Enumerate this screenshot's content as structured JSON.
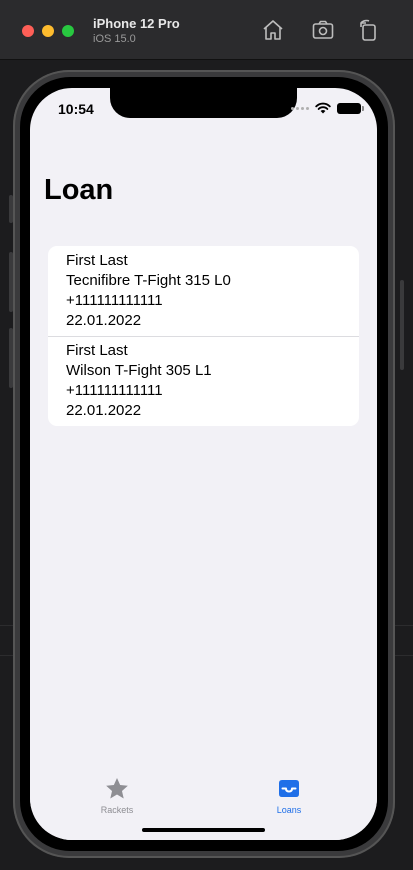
{
  "simulator": {
    "device_name": "iPhone 12 Pro",
    "os_version": "iOS 15.0",
    "icons": [
      "home-icon",
      "screenshot-icon",
      "rotate-icon"
    ]
  },
  "status_bar": {
    "time": "10:54",
    "icons": [
      "cellular-dots-icon",
      "wifi-icon",
      "battery-icon"
    ]
  },
  "page": {
    "title": "Loan"
  },
  "loans": [
    {
      "name": "First Last",
      "racket": "Tecnifibre T-Fight 315 L0",
      "phone": "+111111111111",
      "date": "22.01.2022"
    },
    {
      "name": "First Last",
      "racket": "Wilson T-Fight 305 L1",
      "phone": "+111111111111",
      "date": "22.01.2022"
    }
  ],
  "tab_bar": {
    "tabs": [
      {
        "label": "Rackets",
        "icon": "star-icon",
        "selected": false
      },
      {
        "label": "Loans",
        "icon": "tray-icon",
        "selected": true
      }
    ],
    "accent_color": "#1f6fe8",
    "inactive_color": "#8e8e93"
  }
}
